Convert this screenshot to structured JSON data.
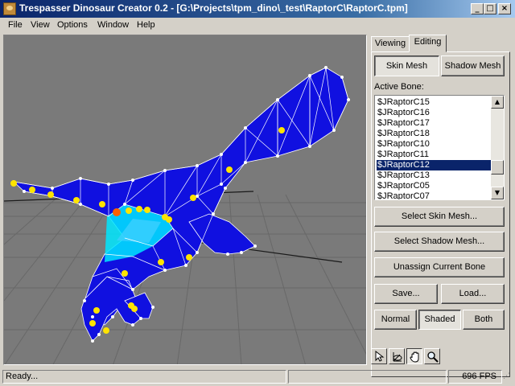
{
  "window": {
    "title": "Trespasser Dinosaur Creator 0.2 - [G:\\Projects\\tpm_dino\\_test\\RaptorC\\RaptorC.tpm]"
  },
  "menu": [
    "File",
    "View",
    "Options",
    "Window",
    "Help"
  ],
  "tabs": {
    "viewing": "Viewing",
    "editing": "Editing"
  },
  "mesh_toggle": {
    "skin": "Skin Mesh",
    "shadow": "Shadow Mesh"
  },
  "active_bone_label": "Active Bone:",
  "bones": [
    "$JRaptorC15",
    "$JRaptorC16",
    "$JRaptorC17",
    "$JRaptorC18",
    "$JRaptorC10",
    "$JRaptorC11",
    "$JRaptorC12",
    "$JRaptorC13",
    "$JRaptorC05",
    "$JRaptorC07"
  ],
  "selected_bone_index": 6,
  "buttons": {
    "select_skin": "Select Skin Mesh...",
    "select_shadow": "Select Shadow Mesh...",
    "unassign": "Unassign Current Bone",
    "save": "Save...",
    "load": "Load..."
  },
  "render_mode": {
    "normal": "Normal",
    "shaded": "Shaded",
    "both": "Both"
  },
  "tools": [
    "pointer-icon",
    "rotate-axes-icon",
    "hand-icon",
    "magnifier-icon"
  ],
  "status": {
    "message": "Ready...",
    "fps": "696 FPS"
  },
  "colors": {
    "mesh": "#1010e0",
    "highlight": "#00e8ff",
    "vertex_marker": "#ffe400",
    "bone_joint": "#ff6000",
    "title_start": "#0a246a"
  }
}
